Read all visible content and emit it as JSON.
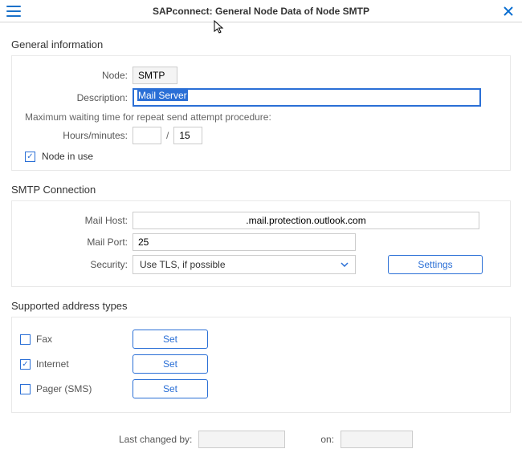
{
  "titlebar": {
    "title": "SAPconnect: General Node Data of Node SMTP"
  },
  "general": {
    "section_title": "General information",
    "node_label": "Node:",
    "node_value": "SMTP",
    "desc_label": "Description:",
    "desc_value": "Mail Server",
    "hint": "Maximum waiting time for repeat send attempt procedure:",
    "hours_label": "Hours/minutes:",
    "hours_value": "",
    "minutes_value": "15",
    "in_use_label": "Node in use",
    "in_use_checked": true
  },
  "smtp": {
    "section_title": "SMTP Connection",
    "host_label": "Mail Host:",
    "host_value": ".mail.protection.outlook.com",
    "port_label": "Mail Port:",
    "port_value": "25",
    "security_label": "Security:",
    "security_value": "Use TLS, if possible",
    "settings_label": "Settings"
  },
  "addr": {
    "section_title": "Supported address types",
    "fax_label": "Fax",
    "fax_checked": false,
    "internet_label": "Internet",
    "internet_checked": true,
    "pager_label": "Pager (SMS)",
    "pager_checked": false,
    "set_label": "Set"
  },
  "footer": {
    "changed_by_label": "Last changed by:",
    "changed_by_value": "",
    "on_label": "on:",
    "on_value": ""
  },
  "glyphs": {
    "check": "✓"
  }
}
